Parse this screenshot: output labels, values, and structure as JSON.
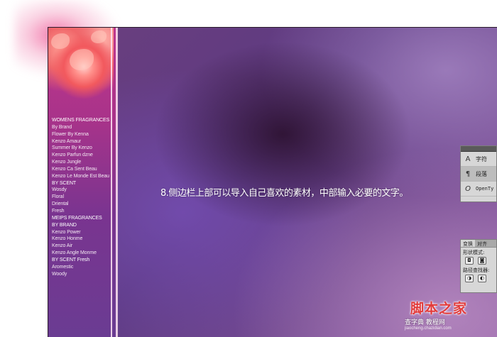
{
  "sidebar": {
    "items": [
      {
        "label": "WOMENS FRAGRANCES",
        "type": "category"
      },
      {
        "label": "By Brand",
        "type": "item"
      },
      {
        "label": "Flower By Kenna",
        "type": "item"
      },
      {
        "label": "Kenzo Amaur",
        "type": "item"
      },
      {
        "label": "Summer By Kenzo",
        "type": "item"
      },
      {
        "label": "Kenzo Parfun dzne",
        "type": "item"
      },
      {
        "label": "Kenzo Jungle",
        "type": "item"
      },
      {
        "label": "Kenzo Ca Sent Beau",
        "type": "item"
      },
      {
        "label": "Kenzo Le Monde Est Beau",
        "type": "item"
      },
      {
        "label": "BY SCENT",
        "type": "category"
      },
      {
        "label": "Wosdy",
        "type": "item"
      },
      {
        "label": "Floral",
        "type": "item"
      },
      {
        "label": "Driental",
        "type": "item"
      },
      {
        "label": "Fresh",
        "type": "item"
      },
      {
        "label": "MEIPS FRAGRANCES",
        "type": "category"
      },
      {
        "label": "BY BRAND",
        "type": "category"
      },
      {
        "label": "Kenzo Power",
        "type": "item"
      },
      {
        "label": "Kenzo Honme",
        "type": "item"
      },
      {
        "label": "Kenzo Air",
        "type": "item"
      },
      {
        "label": "Kenzo Angle Monme",
        "type": "item"
      },
      {
        "label": "BY SCENT Fresh",
        "type": "category"
      },
      {
        "label": "Aromestic",
        "type": "item"
      },
      {
        "label": "Woody",
        "type": "item"
      }
    ]
  },
  "caption": "8.侧边栏上部可以导入自己喜欢的素材，中部输入必要的文字。",
  "char_panel": {
    "rows": [
      {
        "icon": "A",
        "label": "字符",
        "icon_name": "character-icon"
      },
      {
        "icon": "¶",
        "label": "段落",
        "icon_name": "paragraph-icon"
      },
      {
        "icon": "O",
        "label": "OpenTy",
        "icon_name": "opentype-icon"
      }
    ]
  },
  "transform_panel": {
    "tabs": [
      "变换",
      "对齐"
    ],
    "shape_mode_label": "形状模式:",
    "pathfinder_label": "路径查找器:"
  },
  "watermark": {
    "title": "脚本之家",
    "subtitle": "查字典 教程网",
    "url": "jiaocheng.chazidian.com"
  },
  "colors": {
    "sidebar_pink": "#c1358c",
    "canvas_purple": "#5d3a82",
    "watermark_red": "#e23a3a"
  }
}
